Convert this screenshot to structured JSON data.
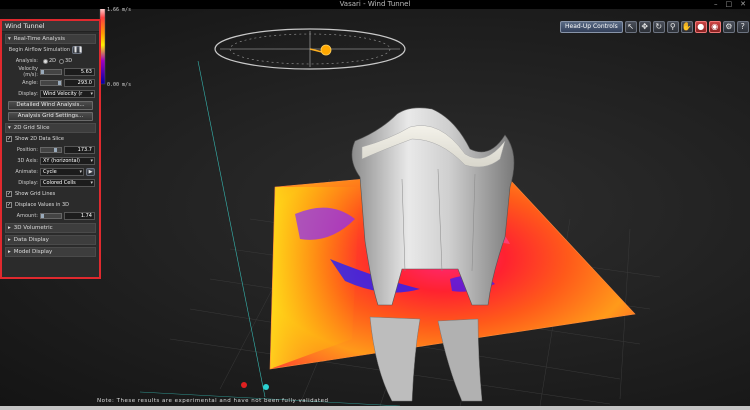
{
  "window": {
    "title": "Vasari - Wind Tunnel",
    "min": "–",
    "max": "□",
    "close": "✕"
  },
  "toolbar": {
    "hud_label": "Head-Up Controls",
    "icons": [
      "cursor-icon",
      "move-icon",
      "rotate-icon",
      "zoom-icon",
      "pan-icon",
      "record-icon",
      "camera-icon",
      "settings-icon",
      "help-icon"
    ]
  },
  "legend": {
    "max_label": "1.66 m/s",
    "min_label": "0.00 m/s"
  },
  "panel": {
    "title": "Wind Tunnel",
    "realtime": {
      "header": "Real-Time Analysis",
      "begin_label": "Begin Airflow Simulation",
      "analysis_label": "Analysis:",
      "opt_2d": "2D",
      "opt_3d": "3D",
      "velocity_label": "Velocity (m/s):",
      "velocity_value": "5.63",
      "angle_label": "Angle:",
      "angle_value": "293.0",
      "display_label": "Display:",
      "display_value": "Wind Velocity (r",
      "btn_detailed": "Detailed Wind Analysis...",
      "btn_grid": "Analysis Grid Settings..."
    },
    "slice": {
      "header": "2D Grid Slice",
      "show_label": "Show 2D Data Slice",
      "position_label": "Position:",
      "position_value": "173.7",
      "axis_label": "3D Axis:",
      "axis_value": "XY (horizontal)",
      "animate_label": "Animate:",
      "animate_value": "Cycle",
      "display_label": "Display:",
      "display_value": "Colored Cells",
      "grid_lines_label": "Show Grid Lines",
      "displace_label": "Displace Values in 3D",
      "amount_label": "Amount:",
      "amount_value": "1.74"
    },
    "sections": [
      "3D Volumetric",
      "Data Display",
      "Model Display"
    ]
  },
  "note": "Note: These results are experimental and have not been fully validated",
  "colors": {
    "accent_red": "#e0292e",
    "hud_blue": "#3a4a66"
  }
}
